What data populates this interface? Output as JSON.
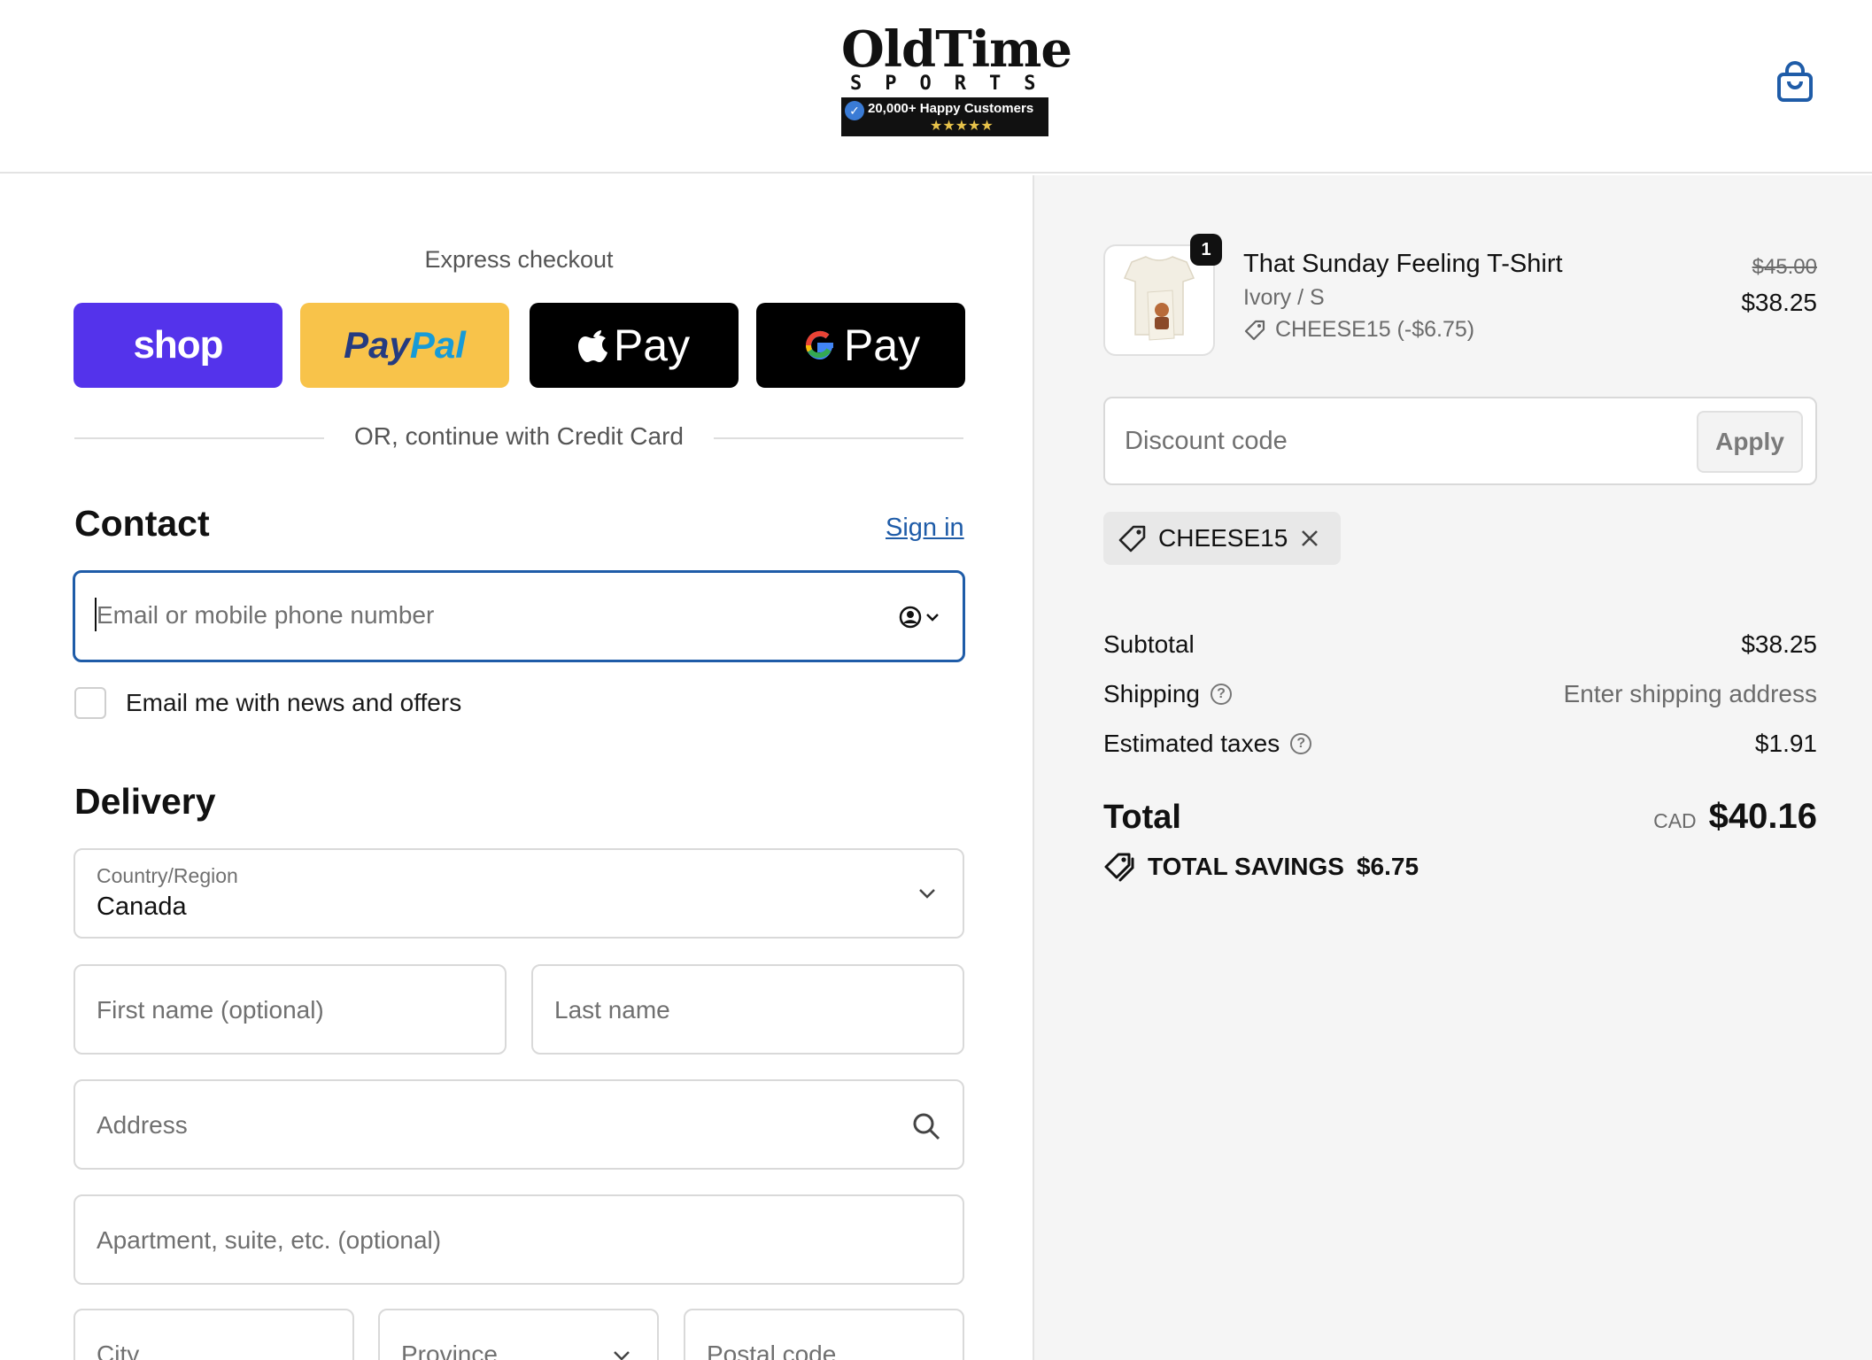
{
  "header": {
    "logo_text": "OldTime",
    "logo_sub": "SPORTS",
    "logo_badge": "20,000+ Happy Customers",
    "logo_stars": "★★★★★",
    "cart_icon": "shopping-bag-icon"
  },
  "express": {
    "title": "Express checkout",
    "shop_label": "shop",
    "paypal_label_1": "Pay",
    "paypal_label_2": "Pal",
    "apple_label": "Pay",
    "google_label": "Pay",
    "or_text": "OR, continue with Credit Card"
  },
  "contact": {
    "title": "Contact",
    "sign_in": "Sign in",
    "email_placeholder": "Email or mobile phone number",
    "news_label": "Email me with news and offers"
  },
  "delivery": {
    "title": "Delivery",
    "country_label": "Country/Region",
    "country_value": "Canada",
    "first_name_placeholder": "First name (optional)",
    "last_name_placeholder": "Last name",
    "address_placeholder": "Address",
    "apartment_placeholder": "Apartment, suite, etc. (optional)",
    "city_placeholder": "City",
    "province_placeholder": "Province",
    "postal_placeholder": "Postal code"
  },
  "summary": {
    "item": {
      "quantity": "1",
      "name": "That Sunday Feeling T-Shirt",
      "variant": "Ivory / S",
      "discount": "CHEESE15 (-$6.75)",
      "old_price": "$45.00",
      "price": "$38.25"
    },
    "discount_placeholder": "Discount code",
    "apply_label": "Apply",
    "applied_code": "CHEESE15",
    "subtotal_label": "Subtotal",
    "subtotal_value": "$38.25",
    "shipping_label": "Shipping",
    "shipping_value": "Enter shipping address",
    "taxes_label": "Estimated taxes",
    "taxes_value": "$1.91",
    "total_label": "Total",
    "currency": "CAD",
    "total_value": "$40.16",
    "savings_label": "TOTAL SAVINGS",
    "savings_value": "$6.75"
  },
  "colors": {
    "accent": "#1f5ca8",
    "shop": "#5433eb",
    "paypal": "#f8c34a",
    "panel_bg": "#f5f5f5"
  }
}
